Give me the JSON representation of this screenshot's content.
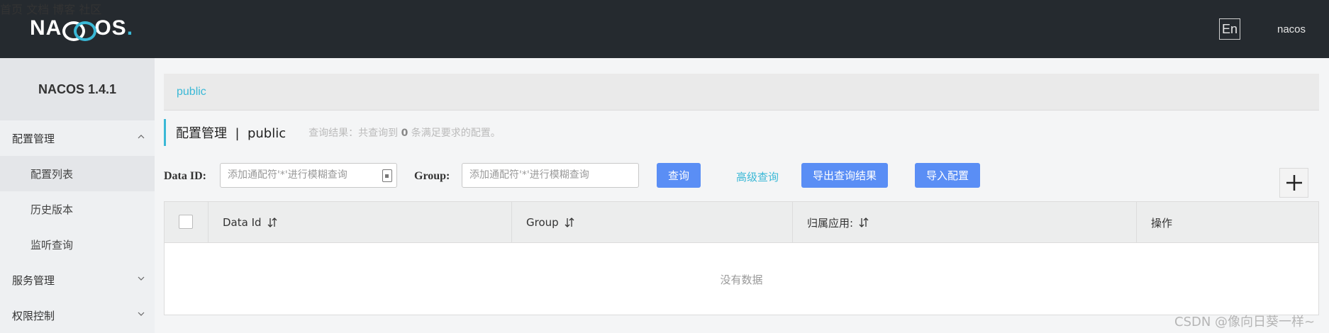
{
  "header": {
    "logo_text_left": "NA",
    "logo_text_right": "OS",
    "logo_dot": ".",
    "nav": [
      "首页",
      "文档",
      "博客",
      "社区"
    ],
    "lang": "En",
    "user": "nacos"
  },
  "sidebar": {
    "title": "NACOS 1.4.1",
    "groups": [
      {
        "label": "配置管理",
        "expanded": true,
        "items": [
          "配置列表",
          "历史版本",
          "监听查询"
        ]
      },
      {
        "label": "服务管理",
        "expanded": false
      },
      {
        "label": "权限控制",
        "expanded": false
      }
    ],
    "active_item": "配置列表"
  },
  "main": {
    "breadcrumb": "public",
    "title": "配置管理  |  public",
    "summary_prefix": "查询结果：共查询到",
    "summary_count": "0",
    "summary_suffix": "条满足要求的配置。",
    "search": {
      "data_id_label": "Data ID:",
      "data_id_placeholder": "添加通配符'*'进行模糊查询",
      "group_label": "Group:",
      "group_placeholder": "添加通配符'*'进行模糊查询",
      "query_button": "查询",
      "advanced_query": "高级查询",
      "export_button": "导出查询结果",
      "import_button": "导入配置"
    },
    "table": {
      "columns": [
        "Data Id",
        "Group",
        "归属应用:",
        "操作"
      ],
      "empty_text": "没有数据"
    }
  },
  "watermark": "CSDN @像向日葵一样~",
  "colors": {
    "header_bg": "#252a2f",
    "accent": "#3ab8d6",
    "primary_button": "#5a8ef5"
  }
}
